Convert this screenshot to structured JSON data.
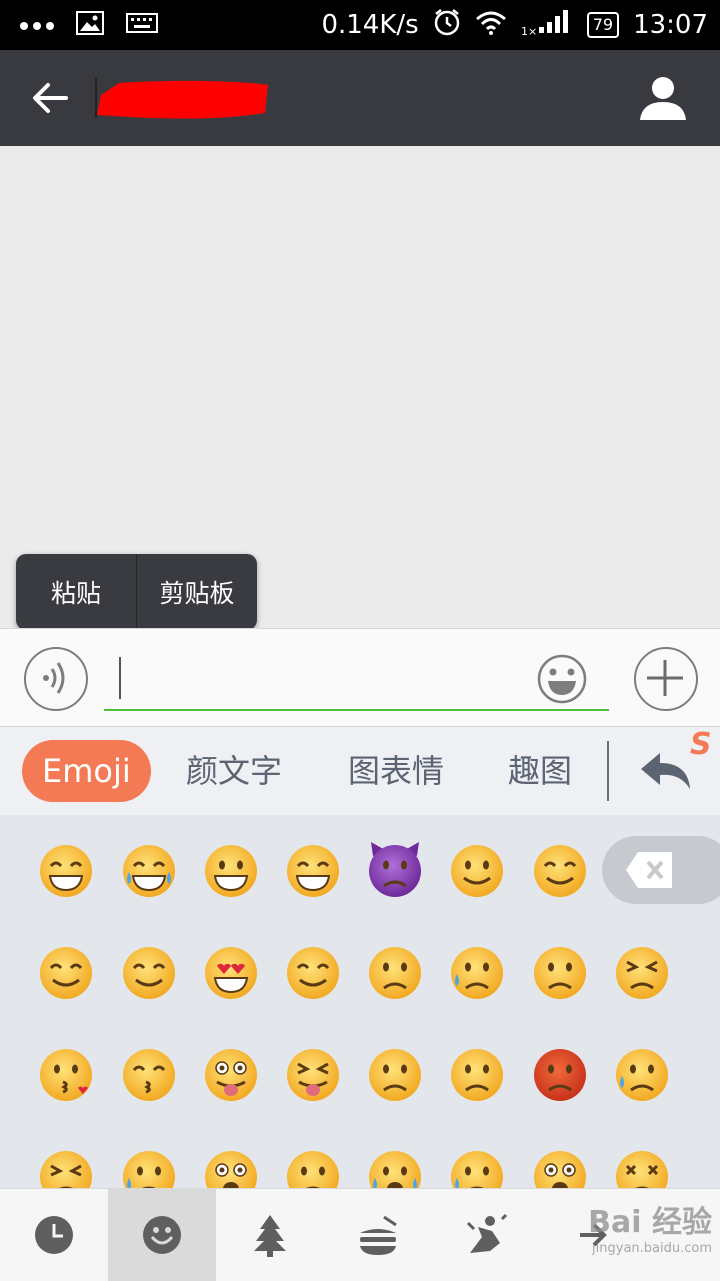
{
  "status_bar": {
    "speed": "0.14K/s",
    "battery": "79",
    "time": "13:07",
    "icons": [
      "more-dots-icon",
      "image-icon",
      "keyboard-icon",
      "alarm-icon",
      "wifi-icon",
      "signal-icon",
      "battery-icon"
    ]
  },
  "header": {
    "title_redacted": true,
    "icons": [
      "back-arrow-icon",
      "profile-icon"
    ]
  },
  "popup_menu": {
    "items": [
      "粘贴",
      "剪贴板"
    ]
  },
  "input_bar": {
    "text_value": "",
    "icons": [
      "voice-icon",
      "emoji-face-icon",
      "plus-icon"
    ],
    "field_accent": "#4cbe3a"
  },
  "keyboard_tabs": {
    "items": [
      "Emoji",
      "颜文字",
      "图表情",
      "趣图"
    ],
    "active": "Emoji",
    "accent": "#f47a55",
    "icons": [
      "return-arrow-icon"
    ]
  },
  "emoji_rows": [
    [
      "grimacing",
      "joy",
      "smiley",
      "grin",
      "imp",
      "wink",
      "blush"
    ],
    [
      "relaxed",
      "relieved",
      "heart-eyes",
      "smirk",
      "unamused",
      "sweat",
      "pensive",
      "confounded"
    ],
    [
      "kissing-heart",
      "kissing-closed-eyes",
      "stuck-out-tongue-winking",
      "stuck-out-tongue-closed",
      "disappointed",
      "angry",
      "rage",
      "cry"
    ],
    [
      "persevere",
      "disappointed-relieved",
      "fearful",
      "sleepy",
      "sob",
      "cold-sweat",
      "scream",
      "dizzy"
    ]
  ],
  "delete_button": {
    "icon": "backspace-icon"
  },
  "category_bar": {
    "items": [
      "clock-icon",
      "smiley-icon",
      "tree-icon",
      "food-icon",
      "sport-icon",
      "other-icon"
    ],
    "active_index": 1
  },
  "watermark": {
    "text": "Bai 经验",
    "sub": "jingyan.baidu.com"
  }
}
